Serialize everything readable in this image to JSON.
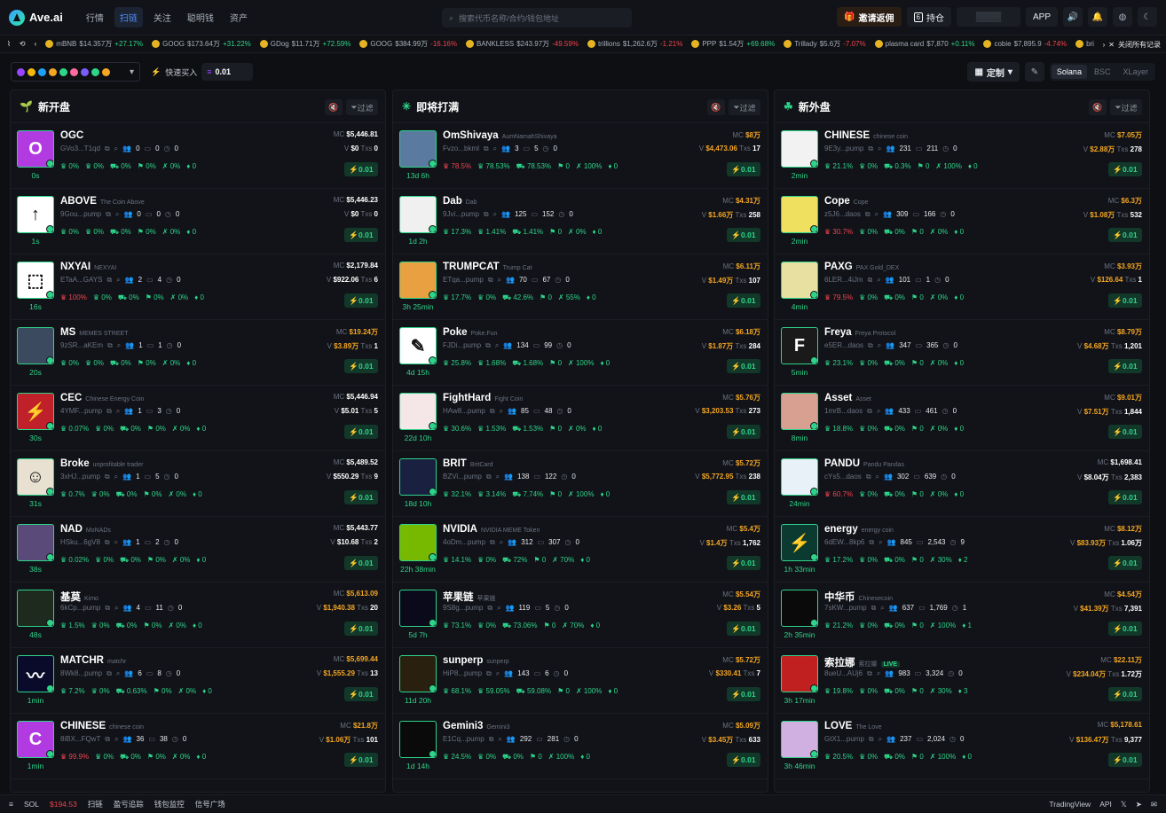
{
  "app": {
    "name": "Ave.ai"
  },
  "nav": [
    "行情",
    "扫链",
    "关注",
    "聪明钱",
    "资产"
  ],
  "search": {
    "placeholder": "搜索代币名称/合约/钱包地址"
  },
  "top": {
    "invite": "邀请返佣",
    "holdings_count": "6",
    "holdings": "持仓",
    "app": "APP"
  },
  "ticker": [
    {
      "name": "mBNB",
      "price": "$14.357万",
      "chg": "+27.17%",
      "up": true
    },
    {
      "name": "GOOG",
      "price": "$173.64万",
      "chg": "+31.22%",
      "up": true
    },
    {
      "name": "GDog",
      "price": "$11.71万",
      "chg": "+72.59%",
      "up": true
    },
    {
      "name": "GOOG",
      "price": "$384.99万",
      "chg": "-16.16%",
      "up": false
    },
    {
      "name": "BANKLESS",
      "price": "$243.97万",
      "chg": "-49.59%",
      "up": false
    },
    {
      "name": "trillions",
      "price": "$1,262.6万",
      "chg": "-1.21%",
      "up": false
    },
    {
      "name": "PPP",
      "price": "$1.54万",
      "chg": "+69.68%",
      "up": true
    },
    {
      "name": "Trillady",
      "price": "$5.6万",
      "chg": "-7.07%",
      "up": false
    },
    {
      "name": "plasma card",
      "price": "$7,870",
      "chg": "+0.11%",
      "up": true
    },
    {
      "name": "cobie",
      "price": "$7,895.9",
      "chg": "-4.74%",
      "up": false
    },
    {
      "name": "bri",
      "price": "",
      "chg": "",
      "up": true
    }
  ],
  "ticker_close": "关闭所有记录",
  "filter": {
    "quick_label": "快速买入",
    "amount": "0.01",
    "custom": "定制",
    "chains": [
      "Solana",
      "BSC",
      "XLayer"
    ]
  },
  "columns": [
    {
      "title": "新开盘",
      "icon": "leaf-icon",
      "filter": "过滤",
      "cards": [
        {
          "avatar": "O",
          "bg": "#b13ae0",
          "age": "0s",
          "name": "OGC",
          "sub": "",
          "addr": "GVo3...T1qd",
          "h": "0",
          "t": "0",
          "o": "0",
          "mc": "$5,446.81",
          "v": "$0",
          "txs": "0",
          "s1": "0%",
          "s2": "0%",
          "s3": "0%",
          "s4": "0%",
          "s5": "0%",
          "s6": "0",
          "r": false,
          "buy": "0.01"
        },
        {
          "avatar": "↑",
          "bg": "#ffffff",
          "age": "1s",
          "name": "ABOVE",
          "sub": "The Coin Above",
          "addr": "9Gou...pump",
          "h": "0",
          "t": "0",
          "o": "0",
          "mc": "$5,446.23",
          "v": "$0",
          "txs": "0",
          "s1": "0%",
          "s2": "0%",
          "s3": "0%",
          "s4": "0%",
          "s5": "0%",
          "s6": "0",
          "r": false,
          "buy": "0.01"
        },
        {
          "avatar": "⬚",
          "bg": "#ffffff",
          "age": "16s",
          "name": "NXYAI",
          "sub": "NEXYAI",
          "addr": "ETaA...GAYS",
          "h": "2",
          "t": "4",
          "o": "0",
          "mc": "$2,179.84",
          "v": "$922.06",
          "txs": "6",
          "s1": "100%",
          "s2": "0%",
          "s3": "0%",
          "s4": "0%",
          "s5": "0%",
          "s6": "0",
          "r": true,
          "buy": "0.01"
        },
        {
          "avatar": "",
          "bg": "#3b4a5e",
          "age": "20s",
          "name": "MS",
          "sub": "MEMES STREET",
          "addr": "9zSR...aKEm",
          "h": "1",
          "t": "1",
          "o": "0",
          "mc": "$19.24万",
          "v": "$3.89万",
          "txs": "1",
          "s1": "0%",
          "s2": "0%",
          "s3": "0%",
          "s4": "0%",
          "s5": "0%",
          "s6": "0",
          "r": false,
          "buy": "0.01",
          "orange": true
        },
        {
          "avatar": "⚡",
          "bg": "#c0202a",
          "age": "30s",
          "name": "CEC",
          "sub": "Chinese Energy Coin",
          "addr": "4YMF...pump",
          "h": "1",
          "t": "3",
          "o": "0",
          "mc": "$5,446.94",
          "v": "$5.01",
          "txs": "5",
          "s1": "0.07%",
          "s2": "0%",
          "s3": "0%",
          "s4": "0%",
          "s5": "0%",
          "s6": "0",
          "r": false,
          "buy": "0.01"
        },
        {
          "avatar": "☺",
          "bg": "#e8e0d0",
          "age": "31s",
          "name": "Broke",
          "sub": "unprofitable trader",
          "addr": "3xHJ...pump",
          "h": "1",
          "t": "5",
          "o": "0",
          "mc": "$5,489.52",
          "v": "$550.29",
          "txs": "9",
          "s1": "0.7%",
          "s2": "0%",
          "s3": "0%",
          "s4": "0%",
          "s5": "0%",
          "s6": "0",
          "r": false,
          "buy": "0.01"
        },
        {
          "avatar": "",
          "bg": "#5a4a7a",
          "age": "38s",
          "name": "NAD",
          "sub": "MoNADs",
          "addr": "HSku...6gV8",
          "h": "1",
          "t": "2",
          "o": "0",
          "mc": "$5,443.77",
          "v": "$10.68",
          "txs": "2",
          "s1": "0.02%",
          "s2": "0%",
          "s3": "0%",
          "s4": "0%",
          "s5": "0%",
          "s6": "0",
          "r": false,
          "buy": "0.01"
        },
        {
          "avatar": "",
          "bg": "#1e2a1e",
          "age": "48s",
          "name": "基莫",
          "sub": "Kimo",
          "addr": "6kCp...pump",
          "h": "4",
          "t": "11",
          "o": "0",
          "mc": "$5,613.09",
          "v": "$1,940.38",
          "txs": "20",
          "s1": "1.5%",
          "s2": "0%",
          "s3": "0%",
          "s4": "0%",
          "s5": "0%",
          "s6": "0",
          "r": false,
          "buy": "0.01",
          "orange": true
        },
        {
          "avatar": "〰",
          "bg": "#0a0a2a",
          "age": "1min",
          "name": "MATCHR",
          "sub": "matchr",
          "addr": "8Wk8...pump",
          "h": "6",
          "t": "8",
          "o": "0",
          "mc": "$5,699.44",
          "v": "$1,555.29",
          "txs": "13",
          "s1": "7.2%",
          "s2": "0%",
          "s3": "0.63%",
          "s4": "0%",
          "s5": "0%",
          "s6": "0",
          "r": false,
          "buy": "0.01",
          "orange": true
        },
        {
          "avatar": "C",
          "bg": "#b13ae0",
          "age": "1min",
          "name": "CHINESE",
          "sub": "chinese coin",
          "addr": "8iBX...FQwT",
          "h": "36",
          "t": "38",
          "o": "0",
          "mc": "$21.8万",
          "v": "$1.06万",
          "txs": "101",
          "s1": "99.9%",
          "s2": "0%",
          "s3": "0%",
          "s4": "0%",
          "s5": "0%",
          "s6": "0",
          "r": true,
          "buy": "0.01",
          "orange": true
        }
      ]
    },
    {
      "title": "即将打满",
      "icon": "sparkle-icon",
      "filter": "过滤",
      "cards": [
        {
          "avatar": "",
          "bg": "#5a7aa0",
          "age": "13d 6h",
          "name": "OmShivaya",
          "sub": "AumNamahShivaya",
          "addr": "Fvzo...bkml",
          "h": "3",
          "t": "5",
          "o": "0",
          "mc": "$8万",
          "v": "$4,473.06",
          "txs": "17",
          "s1": "78.5%",
          "s2": "78.53%",
          "s3": "78.53%",
          "s4": "0",
          "s5": "100%",
          "s6": "0",
          "r": true,
          "buy": "0.01",
          "orange": true
        },
        {
          "avatar": "",
          "bg": "#f0f0f0",
          "age": "1d 2h",
          "name": "Dab",
          "sub": "Dab",
          "addr": "9Jvi...pump",
          "h": "125",
          "t": "152",
          "o": "0",
          "mc": "$4.31万",
          "v": "$1.66万",
          "txs": "258",
          "s1": "17.3%",
          "s2": "1.41%",
          "s3": "1.41%",
          "s4": "0",
          "s5": "0%",
          "s6": "0",
          "r": false,
          "buy": "0.01",
          "orange": true
        },
        {
          "avatar": "",
          "bg": "#e8a040",
          "age": "3h 25min",
          "name": "TRUMPCAT",
          "sub": "Trump Cat",
          "addr": "ETqa...pump",
          "h": "70",
          "t": "67",
          "o": "0",
          "mc": "$6.11万",
          "v": "$1.49万",
          "txs": "107",
          "s1": "17.7%",
          "s2": "0%",
          "s3": "42.6%",
          "s4": "0",
          "s5": "55%",
          "s6": "0",
          "r": false,
          "buy": "0.01",
          "orange": true
        },
        {
          "avatar": "✎",
          "bg": "#ffffff",
          "age": "4d 15h",
          "name": "Poke",
          "sub": "Poke.Fun",
          "addr": "FJDi...pump",
          "h": "134",
          "t": "99",
          "o": "0",
          "mc": "$6.18万",
          "v": "$1.87万",
          "txs": "284",
          "s1": "25.8%",
          "s2": "1.68%",
          "s3": "1.68%",
          "s4": "0",
          "s5": "100%",
          "s6": "0",
          "r": false,
          "buy": "0.01",
          "orange": true
        },
        {
          "avatar": "",
          "bg": "#f5e6e8",
          "age": "22d 10h",
          "name": "FightHard",
          "sub": "Fight Coin",
          "addr": "HAw8...pump",
          "h": "85",
          "t": "48",
          "o": "0",
          "mc": "$5.76万",
          "v": "$3,203.53",
          "txs": "273",
          "s1": "30.6%",
          "s2": "1.53%",
          "s3": "1.53%",
          "s4": "0",
          "s5": "0%",
          "s6": "0",
          "r": false,
          "buy": "0.01",
          "orange": true
        },
        {
          "avatar": "",
          "bg": "#1a2040",
          "age": "18d 10h",
          "name": "BRIT",
          "sub": "BritCard",
          "addr": "BZVi...pump",
          "h": "138",
          "t": "122",
          "o": "0",
          "mc": "$5.72万",
          "v": "$5,772.95",
          "txs": "238",
          "s1": "32.1%",
          "s2": "3.14%",
          "s3": "7.74%",
          "s4": "0",
          "s5": "100%",
          "s6": "0",
          "r": false,
          "buy": "0.01",
          "orange": true
        },
        {
          "avatar": "",
          "bg": "#76b900",
          "age": "22h 38min",
          "name": "NVIDIA",
          "sub": "NVIDIA MEME Token",
          "addr": "4oDm...pump",
          "h": "312",
          "t": "307",
          "o": "0",
          "mc": "$5.4万",
          "v": "$1.4万",
          "txs": "1,762",
          "s1": "14.1%",
          "s2": "0%",
          "s3": "72%",
          "s4": "0",
          "s5": "70%",
          "s6": "0",
          "r": false,
          "buy": "0.01",
          "orange": true
        },
        {
          "avatar": "",
          "bg": "#0a0a1a",
          "age": "5d 7h",
          "name": "苹果链",
          "sub": "苹果链",
          "addr": "9S8g...pump",
          "h": "119",
          "t": "5",
          "o": "0",
          "mc": "$5.54万",
          "v": "$3.26",
          "txs": "5",
          "s1": "73.1%",
          "s2": "0%",
          "s3": "73.06%",
          "s4": "0",
          "s5": "70%",
          "s6": "0",
          "r": false,
          "buy": "0.01",
          "orange": true
        },
        {
          "avatar": "",
          "bg": "#2a2010",
          "age": "11d 20h",
          "name": "sunperp",
          "sub": "sunperp",
          "addr": "HiP8...pump",
          "h": "143",
          "t": "6",
          "o": "0",
          "mc": "$5.72万",
          "v": "$330.41",
          "txs": "7",
          "s1": "68.1%",
          "s2": "59.05%",
          "s3": "59.08%",
          "s4": "0",
          "s5": "100%",
          "s6": "0",
          "r": false,
          "buy": "0.01",
          "orange": true
        },
        {
          "avatar": "",
          "bg": "#0a0a0a",
          "age": "1d 14h",
          "name": "Gemini3",
          "sub": "Gemini3",
          "addr": "E1Cq...pump",
          "h": "292",
          "t": "281",
          "o": "0",
          "mc": "$5.09万",
          "v": "$3.45万",
          "txs": "633",
          "s1": "24.5%",
          "s2": "0%",
          "s3": "0%",
          "s4": "0",
          "s5": "100%",
          "s6": "0",
          "r": false,
          "buy": "0.01",
          "orange": true
        }
      ]
    },
    {
      "title": "新外盘",
      "icon": "clover-icon",
      "filter": "过滤",
      "cards": [
        {
          "avatar": "",
          "bg": "#f2f2f2",
          "age": "2min",
          "name": "CHINESE",
          "sub": "chinese coin",
          "addr": "9E3y...pump",
          "h": "231",
          "t": "211",
          "o": "0",
          "mc": "$7.05万",
          "v": "$2.88万",
          "txs": "278",
          "s1": "21.1%",
          "s2": "0%",
          "s3": "0.3%",
          "s4": "0",
          "s5": "100%",
          "s6": "0",
          "r": false,
          "buy": "0.01",
          "orange": true
        },
        {
          "avatar": "",
          "bg": "#f0e060",
          "age": "2min",
          "name": "Cope",
          "sub": "Cope",
          "addr": "z5J6...daos",
          "h": "309",
          "t": "166",
          "o": "0",
          "mc": "$6.3万",
          "v": "$1.08万",
          "txs": "532",
          "s1": "30.7%",
          "s2": "0%",
          "s3": "0%",
          "s4": "0",
          "s5": "0%",
          "s6": "0",
          "r": true,
          "buy": "0.01",
          "orange": true
        },
        {
          "avatar": "",
          "bg": "#e8e0a0",
          "age": "4min",
          "name": "PAXG",
          "sub": "PAX Gold_DEX",
          "addr": "6LER...4iJm",
          "h": "101",
          "t": "1",
          "o": "0",
          "mc": "$3.93万",
          "v": "$126.64",
          "txs": "1",
          "s1": "79.5%",
          "s2": "0%",
          "s3": "0%",
          "s4": "0",
          "s5": "0%",
          "s6": "0",
          "r": true,
          "buy": "0.01",
          "orange": true
        },
        {
          "avatar": "F",
          "bg": "#1a1a1a",
          "age": "5min",
          "name": "Freya",
          "sub": "Freya Protocol",
          "addr": "e5ER...daos",
          "h": "347",
          "t": "365",
          "o": "0",
          "mc": "$8.79万",
          "v": "$4.68万",
          "txs": "1,201",
          "s1": "23.1%",
          "s2": "0%",
          "s3": "0%",
          "s4": "0",
          "s5": "0%",
          "s6": "0",
          "r": false,
          "buy": "0.01",
          "orange": true
        },
        {
          "avatar": "",
          "bg": "#d8a090",
          "age": "8min",
          "name": "Asset",
          "sub": "Asset",
          "addr": "1mrB...daos",
          "h": "433",
          "t": "461",
          "o": "0",
          "mc": "$9.01万",
          "v": "$7.51万",
          "txs": "1,844",
          "s1": "18.8%",
          "s2": "0%",
          "s3": "0%",
          "s4": "0",
          "s5": "0%",
          "s6": "0",
          "r": false,
          "buy": "0.01",
          "orange": true
        },
        {
          "avatar": "",
          "bg": "#e8f0f8",
          "age": "24min",
          "name": "PANDU",
          "sub": "Pandu Pandas",
          "addr": "cYs5...daos",
          "h": "302",
          "t": "639",
          "o": "0",
          "mc": "$1,698.41",
          "v": "$8.04万",
          "txs": "2,383",
          "s1": "60.7%",
          "s2": "0%",
          "s3": "0%",
          "s4": "0",
          "s5": "0%",
          "s6": "0",
          "r": true,
          "buy": "0.01"
        },
        {
          "avatar": "⚡",
          "bg": "#0a3a30",
          "age": "1h 33min",
          "name": "energy",
          "sub": "energy coin",
          "addr": "6dEW...8kp6",
          "h": "845",
          "t": "2,543",
          "o": "9",
          "mc": "$8.12万",
          "v": "$83.93万",
          "txs": "1.06万",
          "s1": "17.2%",
          "s2": "0%",
          "s3": "0%",
          "s4": "0",
          "s5": "30%",
          "s6": "2",
          "r": false,
          "buy": "0.01",
          "orange": true
        },
        {
          "avatar": "",
          "bg": "#0a0a0a",
          "age": "2h 35min",
          "name": "中华币",
          "sub": "Chinesecoin",
          "addr": "7sKW...pump",
          "h": "637",
          "t": "1,769",
          "o": "1",
          "mc": "$4.54万",
          "v": "$41.39万",
          "txs": "7,391",
          "s1": "21.2%",
          "s2": "0%",
          "s3": "0%",
          "s4": "0",
          "s5": "100%",
          "s6": "1",
          "r": false,
          "buy": "0.01",
          "orange": true
        },
        {
          "avatar": "",
          "bg": "#c02020",
          "age": "3h 17min",
          "name": "索拉娜",
          "sub": "索拉娜",
          "addr": "8ueU...AUj6",
          "h": "983",
          "t": "3,324",
          "o": "0",
          "mc": "$22.11万",
          "v": "$234.04万",
          "txs": "1.72万",
          "s1": "19.8%",
          "s2": "0%",
          "s3": "0%",
          "s4": "0",
          "s5": "30%",
          "s6": "3",
          "r": false,
          "buy": "0.01",
          "orange": true,
          "live": "LIVE"
        },
        {
          "avatar": "",
          "bg": "#d0b0e0",
          "age": "3h 46min",
          "name": "LOVE",
          "sub": "The Love",
          "addr": "GtX1...pump",
          "h": "237",
          "t": "2,024",
          "o": "0",
          "mc": "$5,178.61",
          "v": "$136.47万",
          "txs": "9,377",
          "s1": "20.5%",
          "s2": "0%",
          "s3": "0%",
          "s4": "0",
          "s5": "100%",
          "s6": "0",
          "r": false,
          "buy": "0.01",
          "orange": true
        }
      ]
    }
  ],
  "bottom": {
    "sol_label": "SOL",
    "sol_price": "$194.53",
    "items": [
      "扫链",
      "盈亏追踪",
      "钱包监控",
      "信号广场"
    ],
    "tv": "TradingView",
    "api": "API"
  }
}
